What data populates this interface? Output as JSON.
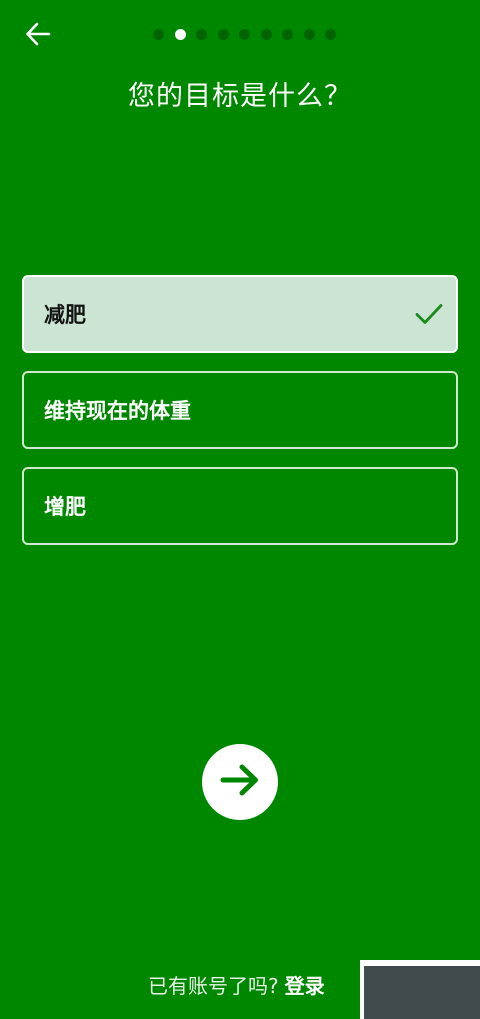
{
  "header": {
    "back_icon": "arrow-left-icon",
    "progress": {
      "total_steps": 9,
      "current_step": 2
    }
  },
  "title": "您的目标是什么？",
  "options": [
    {
      "label": "减肥",
      "selected": true
    },
    {
      "label": "维持现在的体重",
      "selected": false
    },
    {
      "label": "增肥",
      "selected": false
    }
  ],
  "next_button": {
    "icon": "arrow-right-icon"
  },
  "footer": {
    "prompt": "已有账号了吗?",
    "login_label": "登录"
  },
  "colors": {
    "background": "#008700",
    "dot_inactive": "#006400",
    "selected_option_bg": "#cce4d3",
    "check": "#1a8a1a",
    "arrow": "#008700"
  }
}
